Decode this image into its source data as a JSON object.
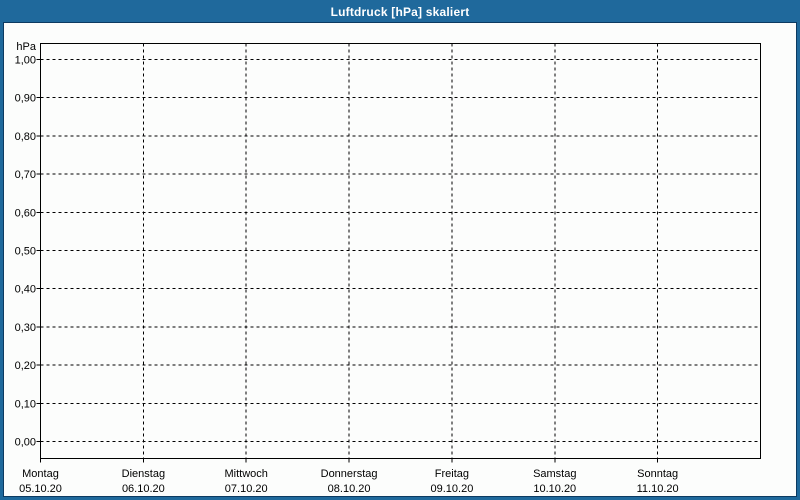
{
  "window": {
    "title": "Luftdruck [hPa] skaliert"
  },
  "colors": {
    "frame_blue": "#1f699c",
    "bevel_dark": "#0c3a61",
    "title_text": "#ffffff",
    "chart_background": "#fcfdfc",
    "grid_line": "#000000",
    "axis_line": "#000000",
    "label_text": "#000000"
  },
  "chart_data": {
    "type": "line",
    "title": "Luftdruck [hPa] skaliert",
    "series": [],
    "grid": "dashed",
    "legend": "none",
    "y_axis": {
      "unit": "hPa",
      "min": 0,
      "max": 1,
      "step": 0.1,
      "tick_labels_top_to_bottom": [
        "1,00",
        "0,90",
        "0,80",
        "0,70",
        "0,60",
        "0,50",
        "0,40",
        "0,30",
        "0,20",
        "0,10",
        "0,00"
      ]
    },
    "x_axis": {
      "categories": [
        {
          "day": "Montag",
          "date": "05.10.20"
        },
        {
          "day": "Dienstag",
          "date": "06.10.20"
        },
        {
          "day": "Mittwoch",
          "date": "07.10.20"
        },
        {
          "day": "Donnerstag",
          "date": "08.10.20"
        },
        {
          "day": "Freitag",
          "date": "09.10.20"
        },
        {
          "day": "Samstag",
          "date": "10.10.20"
        },
        {
          "day": "Sonntag",
          "date": "11.10.20"
        }
      ]
    }
  }
}
